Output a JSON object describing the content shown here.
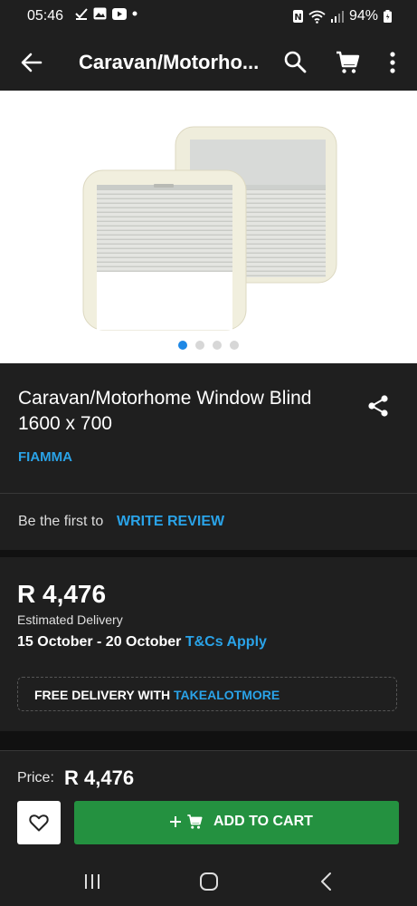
{
  "status_bar": {
    "time": "05:46",
    "battery": "94%"
  },
  "app_bar": {
    "title": "Caravan/Motorho..."
  },
  "gallery": {
    "image_count": 4,
    "active_index": 0
  },
  "product": {
    "title": "Caravan/Motorhome Window Blind 1600 x 700",
    "brand": "FIAMMA"
  },
  "review": {
    "prompt": "Be the first to",
    "link": "WRITE REVIEW"
  },
  "pricing": {
    "price": "R 4,476",
    "delivery_label": "Estimated Delivery",
    "delivery_dates": "15 October - 20 October",
    "tc_link": "T&Cs Apply",
    "promo_prefix": "FREE DELIVERY WITH",
    "promo_highlight": "TAKEALOTMORE"
  },
  "footer": {
    "price_label": "Price:",
    "price_value": "R 4,476",
    "add_to_cart": "ADD TO CART"
  },
  "colors": {
    "accent_blue": "#2aa3e8",
    "cart_green": "#249140",
    "background": "#1f1f1f"
  }
}
